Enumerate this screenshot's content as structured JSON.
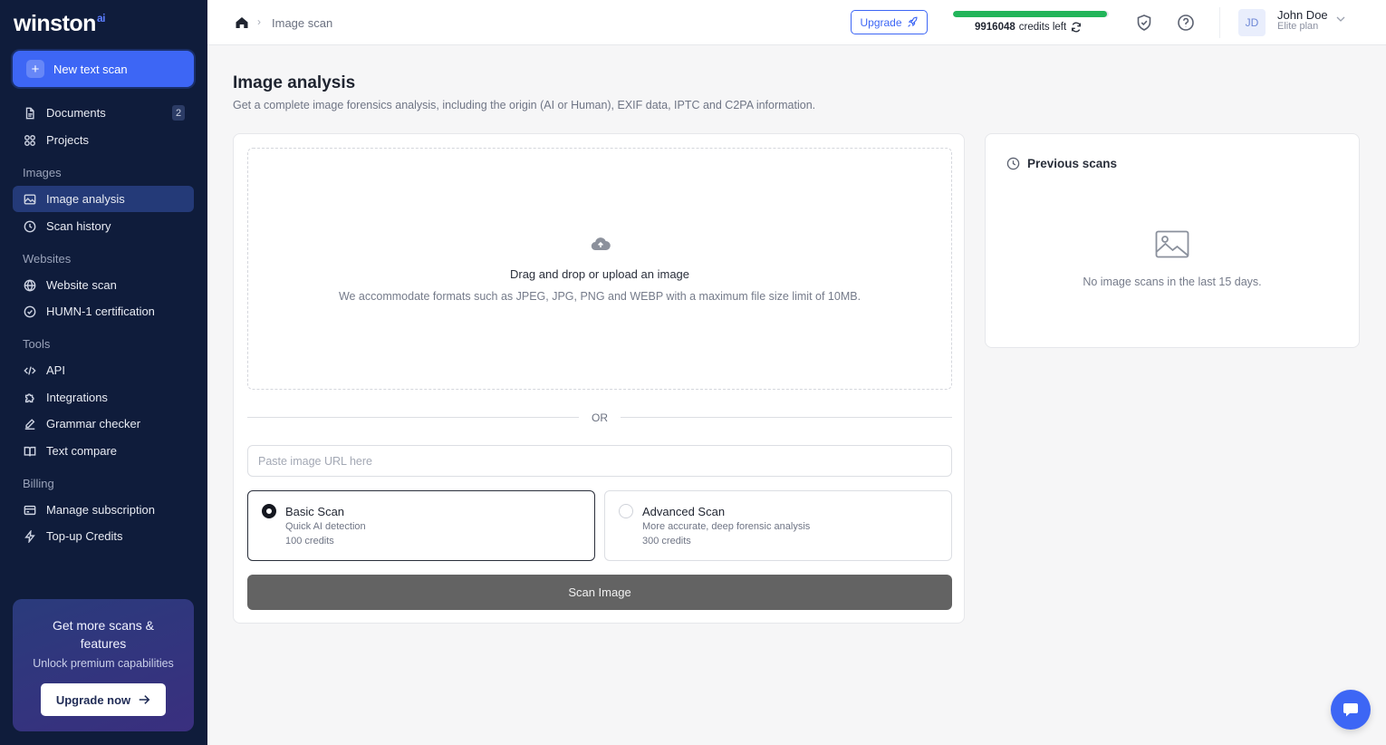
{
  "app": {
    "logo_text": "winston",
    "logo_suffix": "ai"
  },
  "sidebar": {
    "new_scan_label": "New text scan",
    "items_top": [
      {
        "label": "Documents",
        "badge": "2"
      },
      {
        "label": "Projects"
      }
    ],
    "section_images": "Images",
    "items_images": [
      {
        "label": "Image analysis",
        "active": true
      },
      {
        "label": "Scan history"
      }
    ],
    "section_websites": "Websites",
    "items_websites": [
      {
        "label": "Website scan"
      },
      {
        "label": "HUMN-1 certification"
      }
    ],
    "section_tools": "Tools",
    "items_tools": [
      {
        "label": "API"
      },
      {
        "label": "Integrations"
      },
      {
        "label": "Grammar checker"
      },
      {
        "label": "Text compare"
      }
    ],
    "section_billing": "Billing",
    "items_billing": [
      {
        "label": "Manage subscription"
      },
      {
        "label": "Top-up Credits"
      }
    ],
    "promo": {
      "title": "Get more scans & features",
      "subtitle": "Unlock premium capabilities",
      "button": "Upgrade now"
    }
  },
  "topbar": {
    "breadcrumb_current": "Image scan",
    "upgrade_label": "Upgrade",
    "credits_value": "9916048",
    "credits_suffix": "credits left",
    "credits_fill_fraction": 0.99,
    "user": {
      "initials": "JD",
      "name": "John Doe",
      "plan": "Elite plan"
    }
  },
  "main": {
    "title": "Image analysis",
    "subtitle": "Get a complete image forensics analysis, including the origin (AI or Human), EXIF data, IPTC and C2PA information.",
    "dropzone": {
      "title": "Drag and drop or upload an image",
      "subtitle": "We accommodate formats such as JPEG, JPG, PNG and WEBP with a maximum file size limit of 10MB."
    },
    "or_label": "OR",
    "url_placeholder": "Paste image URL here",
    "options": [
      {
        "title": "Basic Scan",
        "desc": "Quick AI detection",
        "credits": "100 credits",
        "selected": true
      },
      {
        "title": "Advanced Scan",
        "desc": "More accurate, deep forensic analysis",
        "credits": "300 credits",
        "selected": false
      }
    ],
    "scan_button": "Scan Image"
  },
  "previous": {
    "title": "Previous scans",
    "empty_text": "No image scans in the last 15 days."
  },
  "colors": {
    "sidebar_bg": "#0f1c3b",
    "accent": "#3d66f5",
    "credits_green": "#22b55a"
  }
}
